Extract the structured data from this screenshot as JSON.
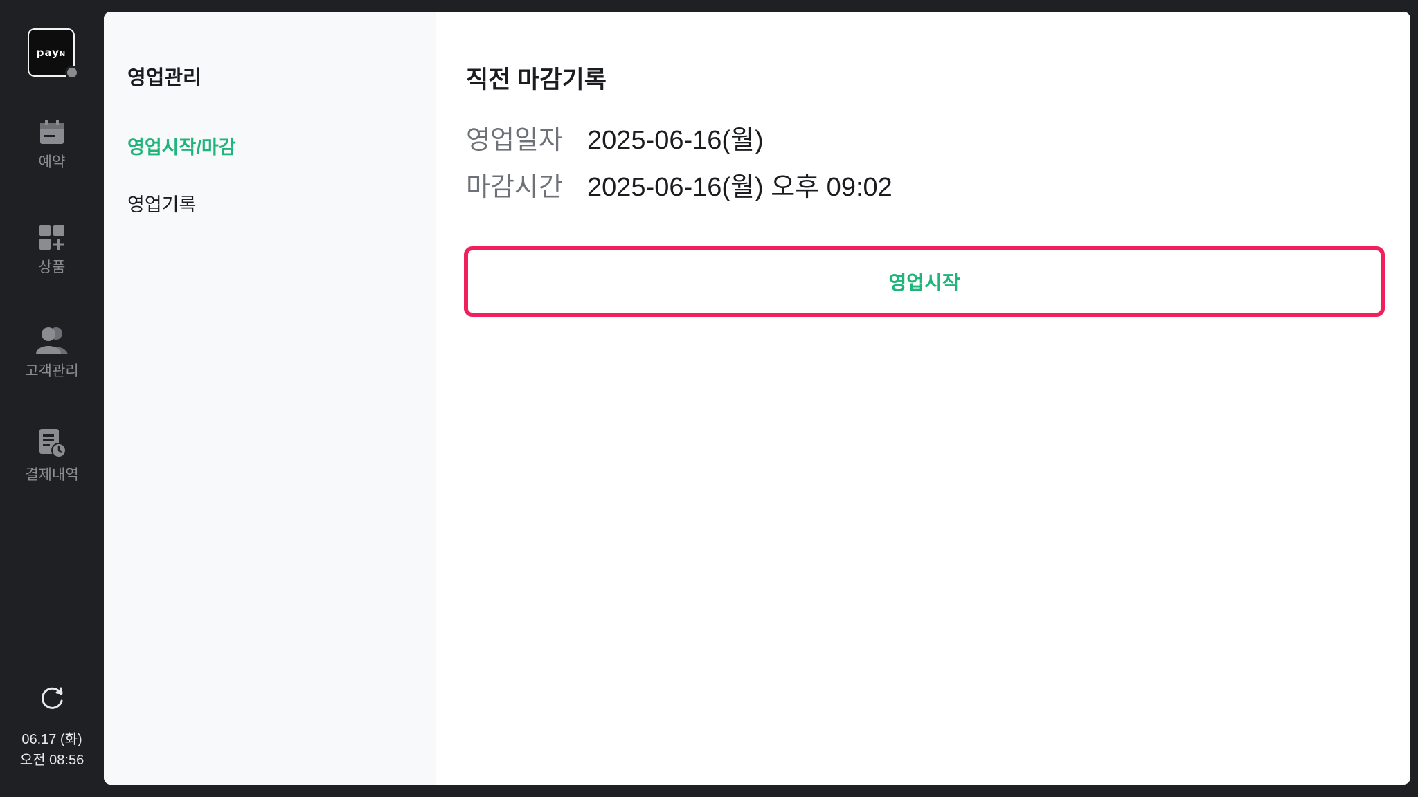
{
  "brand": {
    "logo_text": "pay",
    "logo_suffix": "N"
  },
  "rail": {
    "items": [
      {
        "label": "예약",
        "icon": "calendar-icon"
      },
      {
        "label": "상품",
        "icon": "grid-plus-icon"
      },
      {
        "label": "고객관리",
        "icon": "users-icon"
      },
      {
        "label": "결제내역",
        "icon": "receipt-clock-icon"
      }
    ],
    "date": "06.17 (화)",
    "time": "오전 08:56"
  },
  "submenu": {
    "title": "영업관리",
    "items": [
      {
        "label": "영업시작/마감",
        "active": true
      },
      {
        "label": "영업기록",
        "active": false
      }
    ]
  },
  "main": {
    "title": "직전 마감기록",
    "business_date_label": "영업일자",
    "business_date_value": "2025-06-16(월)",
    "close_time_label": "마감시간",
    "close_time_value": "2025-06-16(월) 오후 09:02",
    "start_button_label": "영업시작"
  },
  "colors": {
    "accent_green": "#1fb57a",
    "highlight_red": "#f0205c",
    "rail_bg": "#1f2023"
  }
}
